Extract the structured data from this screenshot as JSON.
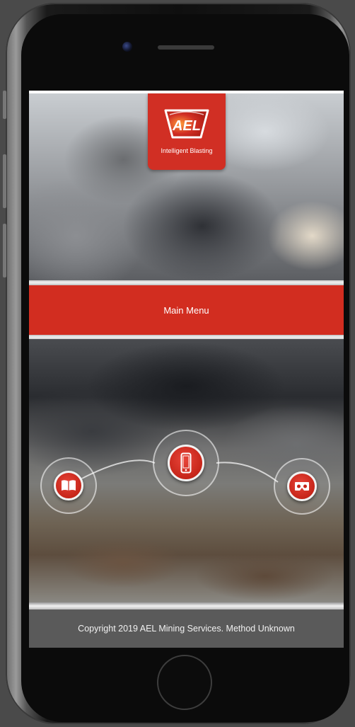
{
  "header": {
    "brand": "AEL",
    "tagline": "Intelligent Blasting"
  },
  "menu": {
    "label": "Main Menu"
  },
  "navigation": {
    "items": [
      {
        "icon": "book-icon"
      },
      {
        "icon": "phone-icon"
      },
      {
        "icon": "vr-headset-icon"
      }
    ]
  },
  "footer": {
    "text": "Copyright 2019 AEL Mining Services. Method Unknown"
  },
  "colors": {
    "brand_red": "#d22d20",
    "footer_gray": "#5a5a5a"
  }
}
